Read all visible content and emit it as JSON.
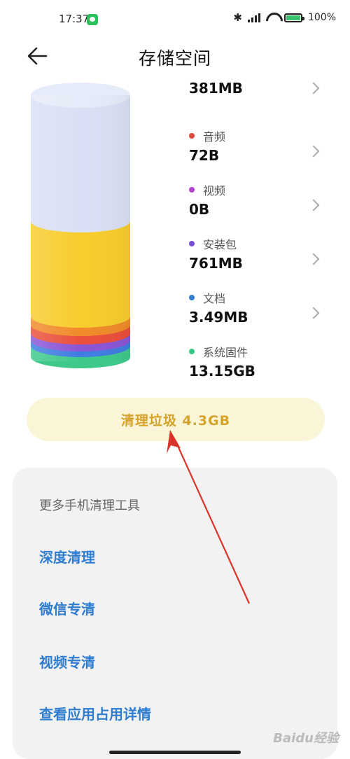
{
  "status_bar": {
    "time": "17:37",
    "battery": "100%",
    "icons": [
      "wechat-icon",
      "bluetooth-icon",
      "signal-icon",
      "wifi-icon",
      "battery-icon"
    ]
  },
  "header": {
    "title": "存储空间",
    "back_icon": "arrow-left-icon"
  },
  "storage_chart": {
    "segments_top_to_bottom": [
      {
        "name": "free",
        "color": "#d7def5"
      },
      {
        "name": "other",
        "color": "#f7cc2c"
      },
      {
        "name": "orange",
        "color": "#f08a2a"
      },
      {
        "name": "red",
        "color": "#ea4f3b"
      },
      {
        "name": "purple",
        "color": "#8a55d6"
      },
      {
        "name": "blue",
        "color": "#3f7de0"
      },
      {
        "name": "green",
        "color": "#3ec98a"
      }
    ]
  },
  "categories": [
    {
      "label": "",
      "size": "381MB",
      "color": ""
    },
    {
      "label": "音频",
      "size": "72B",
      "color": "#e2483a"
    },
    {
      "label": "视频",
      "size": "0B",
      "color": "#b443cf"
    },
    {
      "label": "安装包",
      "size": "761MB",
      "color": "#7a4fd6"
    },
    {
      "label": "文档",
      "size": "3.49MB",
      "color": "#2f7dd1"
    },
    {
      "label": "系统固件",
      "size": "13.15GB",
      "color": "#35c785"
    }
  ],
  "clean_button": {
    "label": "清理垃圾 4.3GB"
  },
  "tools": {
    "title": "更多手机清理工具",
    "items": [
      "深度清理",
      "微信专清",
      "视频专清",
      "查看应用占用详情"
    ]
  },
  "watermark": "Baidu经验"
}
